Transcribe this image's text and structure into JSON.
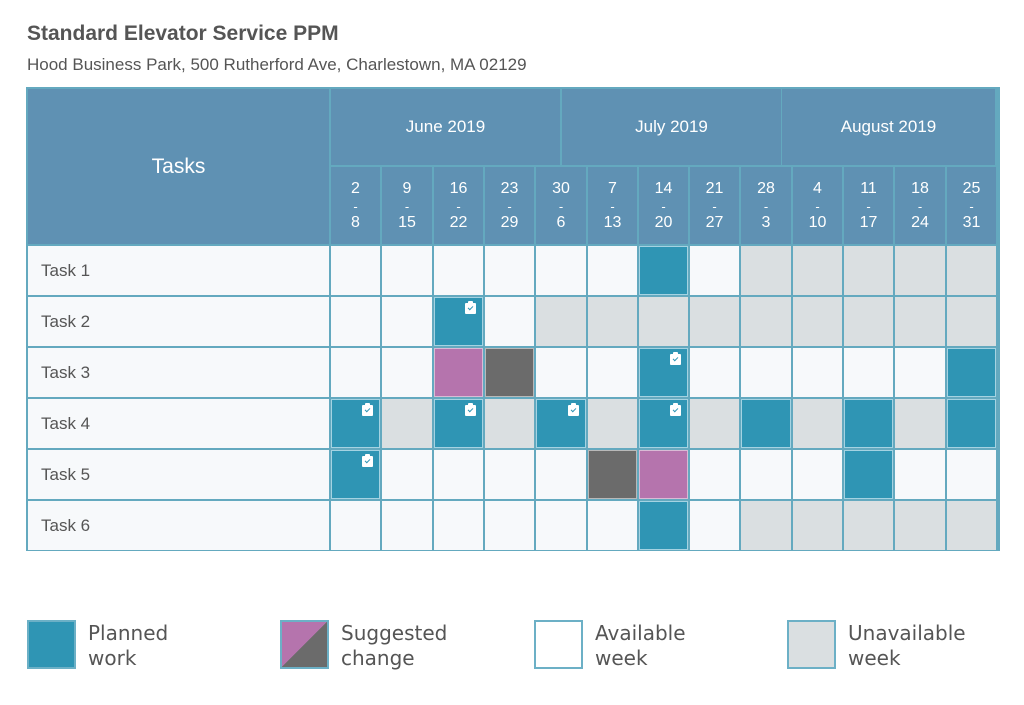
{
  "header": {
    "title": "Standard Elevator Service PPM",
    "subtitle": "Hood Business Park, 500 Rutherford Ave, Charlestown, MA 02129"
  },
  "colors": {
    "planned": "#2f95b4",
    "suggested_from": "#b574ad",
    "suggested_to": "#6b6b6b",
    "available": "#f7f9fb",
    "unavailable": "#dadfe1",
    "header_bg": "#5f91b3",
    "grid_line": "#64a9bf"
  },
  "chart_data": {
    "type": "table",
    "title": "Standard Elevator Service PPM",
    "tasks_header": "Tasks",
    "months": [
      {
        "label": "June 2019",
        "weeks_span": 4.5
      },
      {
        "label": "July 2019",
        "weeks_span": 4.3
      },
      {
        "label": "August 2019",
        "weeks_span": 4.2
      }
    ],
    "weeks": [
      {
        "start": "2",
        "end": "8"
      },
      {
        "start": "9",
        "end": "15"
      },
      {
        "start": "16",
        "end": "22"
      },
      {
        "start": "23",
        "end": "29"
      },
      {
        "start": "30",
        "end": "6"
      },
      {
        "start": "7",
        "end": "13"
      },
      {
        "start": "14",
        "end": "20"
      },
      {
        "start": "21",
        "end": "27"
      },
      {
        "start": "28",
        "end": "3"
      },
      {
        "start": "4",
        "end": "10"
      },
      {
        "start": "11",
        "end": "17"
      },
      {
        "start": "18",
        "end": "24"
      },
      {
        "start": "25",
        "end": "31"
      }
    ],
    "legend": [
      {
        "key": "planned",
        "line1": "Planned",
        "line2": "work"
      },
      {
        "key": "suggested",
        "line1": "Suggested",
        "line2": "change"
      },
      {
        "key": "available",
        "line1": "Available",
        "line2": "week"
      },
      {
        "key": "unavailable",
        "line1": "Unavailable",
        "line2": "week"
      }
    ],
    "rows": [
      {
        "task": "Task 1",
        "cells": [
          "available",
          "available",
          "available",
          "available",
          "available",
          "available",
          "planned",
          "available",
          "unavailable",
          "unavailable",
          "unavailable",
          "unavailable",
          "unavailable"
        ],
        "checked": []
      },
      {
        "task": "Task 2",
        "cells": [
          "available",
          "available",
          "planned",
          "available",
          "unavailable",
          "unavailable",
          "unavailable",
          "unavailable",
          "unavailable",
          "unavailable",
          "unavailable",
          "unavailable",
          "unavailable"
        ],
        "checked": [
          2
        ]
      },
      {
        "task": "Task 3",
        "cells": [
          "available",
          "available",
          "suggested-from",
          "suggested-to",
          "available",
          "available",
          "planned",
          "available",
          "available",
          "available",
          "available",
          "available",
          "planned"
        ],
        "checked": [
          6
        ]
      },
      {
        "task": "Task 4",
        "cells": [
          "planned",
          "unavailable",
          "planned",
          "unavailable",
          "planned",
          "unavailable",
          "planned",
          "unavailable",
          "planned",
          "unavailable",
          "planned",
          "unavailable",
          "planned"
        ],
        "checked": [
          0,
          2,
          4,
          6
        ]
      },
      {
        "task": "Task 5",
        "cells": [
          "planned",
          "available",
          "available",
          "available",
          "available",
          "suggested-to",
          "suggested-from",
          "available",
          "available",
          "available",
          "planned",
          "available",
          "available"
        ],
        "checked": [
          0
        ]
      },
      {
        "task": "Task 6",
        "cells": [
          "available",
          "available",
          "available",
          "available",
          "available",
          "available",
          "planned",
          "available",
          "unavailable",
          "unavailable",
          "unavailable",
          "unavailable",
          "unavailable"
        ],
        "checked": []
      }
    ]
  }
}
